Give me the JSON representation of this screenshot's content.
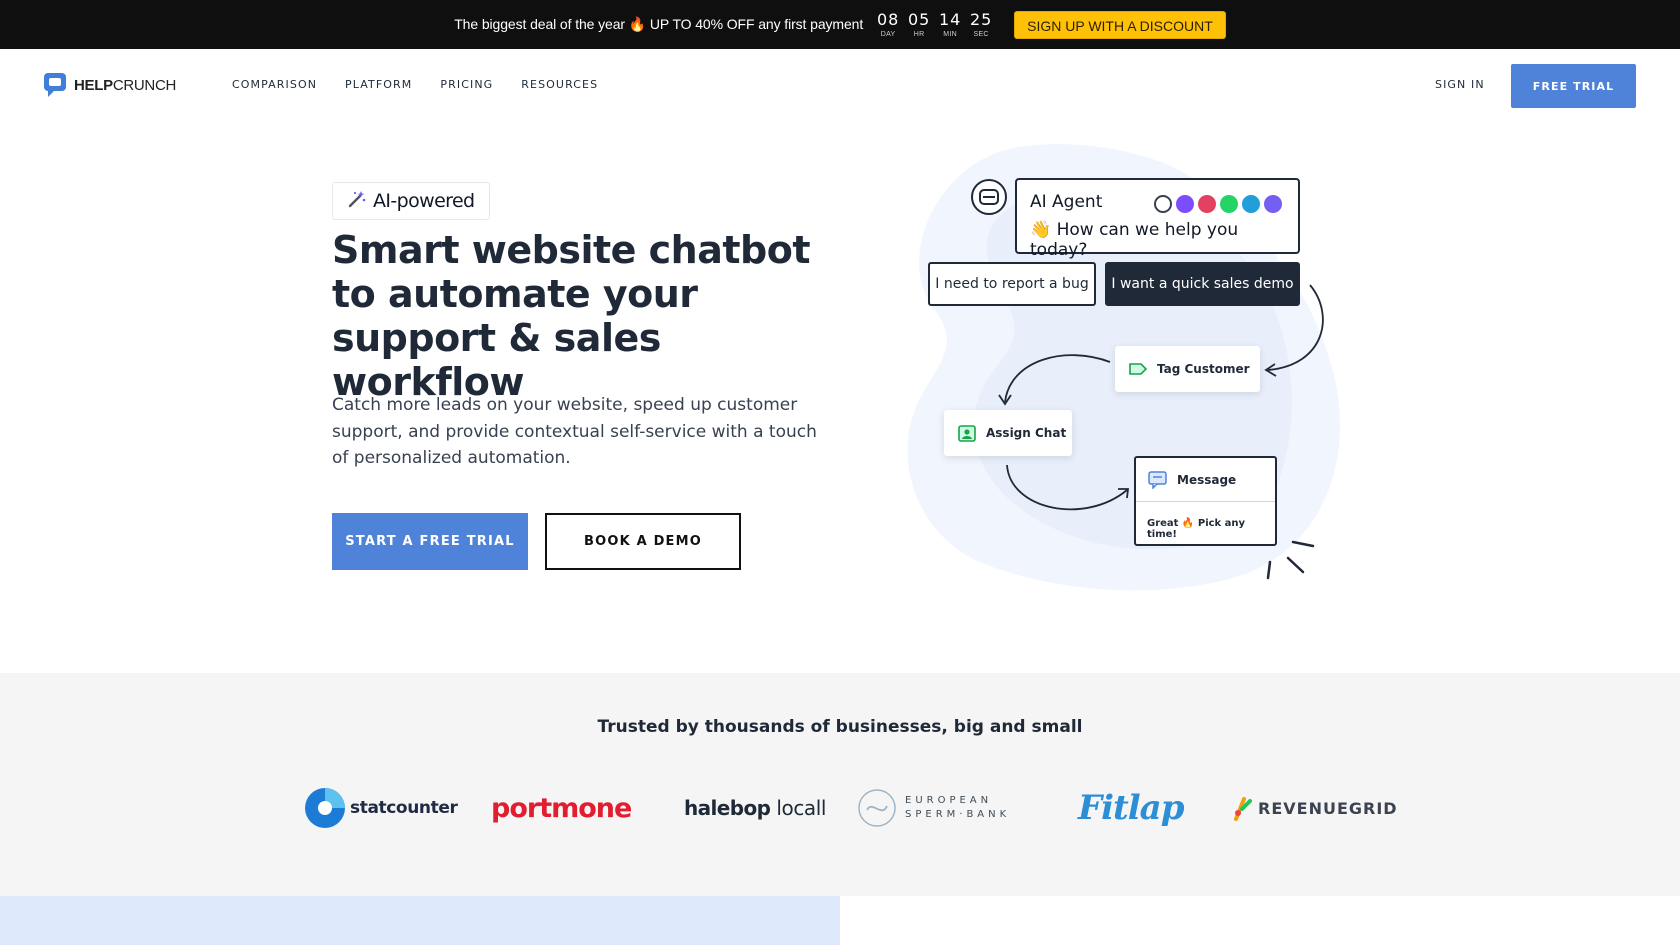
{
  "promo": {
    "text_before": "The biggest deal of the year",
    "flame": "🔥",
    "text_after": "UP TO 40% OFF any first payment",
    "countdown": [
      {
        "value": "08",
        "unit": "DAY"
      },
      {
        "value": "05",
        "unit": "HR"
      },
      {
        "value": "14",
        "unit": "MIN"
      },
      {
        "value": "25",
        "unit": "SEC"
      }
    ],
    "cta": "SIGN UP WITH A DISCOUNT"
  },
  "nav": {
    "logo_bold": "HELP",
    "logo_light": "CRUNCH",
    "links": [
      "COMPARISON",
      "PLATFORM",
      "PRICING",
      "RESOURCES"
    ],
    "sign_in": "SIGN IN",
    "free_trial": "FREE TRIAL"
  },
  "hero": {
    "badge": "AI-powered",
    "title_bold": "Smart website chatbot",
    "title_rest": " to automate your support & sales workflow",
    "description": "Catch more leads on your website, speed up customer support, and provide contextual self-service with a touch of personalized automation.",
    "primary_cta": "START A FREE TRIAL",
    "secondary_cta": "BOOK A DEMO"
  },
  "illustration": {
    "agent_title": "AI Agent",
    "agent_message": "👋 How can we help you today?",
    "reply_bug": "I need to report a bug",
    "reply_demo": "I want a quick sales demo",
    "tag_customer": "Tag Customer",
    "assign_chat": "Assign Chat",
    "message_title": "Message",
    "message_body": "Great 🔥 Pick any time!",
    "channel_colors": [
      "#374151",
      "#7b4dff",
      "#e4405f",
      "#25d366",
      "#229ed9",
      "#7360f2"
    ]
  },
  "trusted": {
    "title": "Trusted by thousands of businesses, big and small",
    "logos": [
      "statcounter",
      "portmone",
      "halebop",
      "locall",
      "EUROPEAN",
      "SPERM·BANK",
      "Fitlap",
      "REVENUEGRID"
    ]
  },
  "colors": {
    "accent": "#4f83d9",
    "promo_bg": "#0f0f10",
    "promo_cta": "#ffc107"
  }
}
